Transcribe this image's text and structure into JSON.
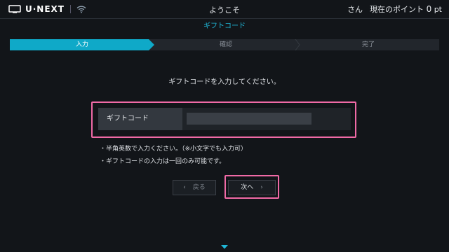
{
  "header": {
    "logo_text": "U·NEXT",
    "welcome": "ようこそ",
    "user_suffix": "さん",
    "points_label": "現在のポイント",
    "points_value": "0",
    "points_unit": "pt"
  },
  "page_title": "ギフトコード",
  "steps": [
    {
      "label": "入力",
      "active": true
    },
    {
      "label": "確認",
      "active": false
    },
    {
      "label": "完了",
      "active": false
    }
  ],
  "instruction": "ギフトコードを入力してください。",
  "form": {
    "label": "ギフトコード",
    "value": ""
  },
  "notes": [
    "・半角英数で入力ください。（※小文字でも入力可）",
    "・ギフトコードの入力は一回のみ可能です。"
  ],
  "buttons": {
    "back_label": "戻る",
    "next_label": "次へ"
  },
  "colors": {
    "accent": "#0fa9c8",
    "focus": "#f06aa6",
    "background": "#121519"
  },
  "icons": {
    "logo": "tv-icon",
    "network": "wifi-icon",
    "back": "chevron-left-icon",
    "next": "chevron-right-icon",
    "scroll": "chevron-down-icon"
  }
}
